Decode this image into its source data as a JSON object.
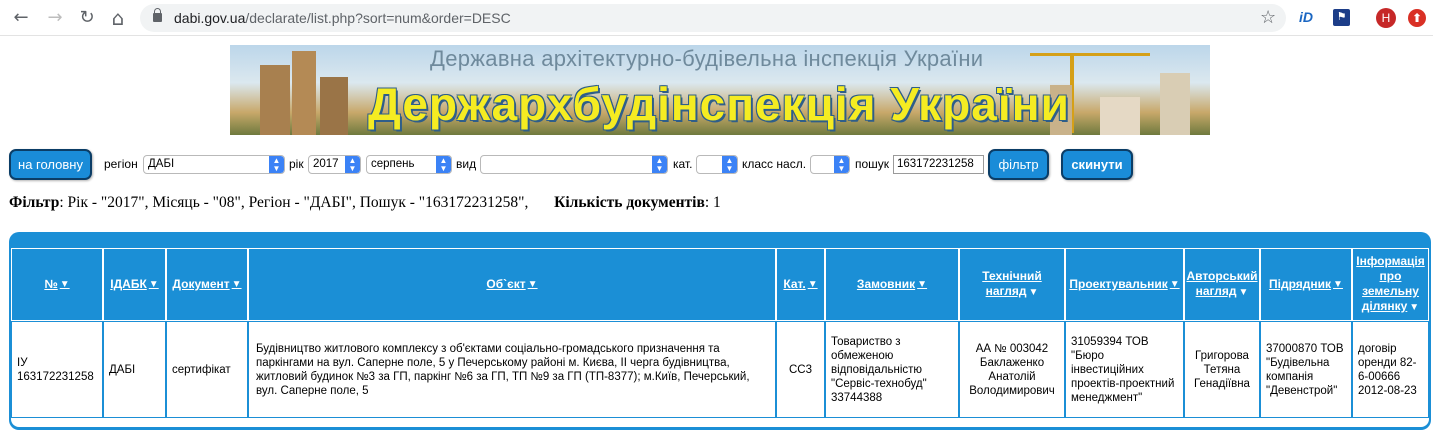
{
  "browser": {
    "url_host": "dabi.gov.ua",
    "url_path": "/declarate/list.php?sort=num&order=DESC",
    "back_icon": "←",
    "forward_icon": "→",
    "reload_icon": "↻",
    "home_icon": "⌂",
    "star_icon": "☆",
    "ext_id_label": "iD",
    "avatar_letter": "Н",
    "update_icon": "⬆"
  },
  "banner": {
    "subtitle": "Державна архітектурно-будівельна інспекція України",
    "title": "Держархбудінспекція України"
  },
  "filters": {
    "home_button": "на головну",
    "region_label": "регіон",
    "region_value": "ДАБІ",
    "year_label": "рік",
    "year_value": "2017",
    "month_value": "серпень",
    "type_label": "вид",
    "type_value": "",
    "category_label": "кат.",
    "category_value": "",
    "class_label": "класс насл.",
    "class_value": "",
    "search_label": "пошук",
    "search_value": "163172231258",
    "filter_button": "фільтр",
    "reset_button": "скинути"
  },
  "summary": {
    "filter_label": "Фільтр",
    "filter_text": ": Рік - \"2017\", Місяць - \"08\", Регіон - \"ДАБІ\", Пошук - \"163172231258\",",
    "count_label": "Кількість документів",
    "count_text": ": 1"
  },
  "table": {
    "sort_icon": "▼",
    "headers": {
      "num": "№",
      "idabk": "ІДАБК",
      "document": "Документ",
      "object": "Об`єкт",
      "category": "Кат.",
      "customer": "Замовник",
      "tech_supervision_1": "Технічний",
      "tech_supervision_2": "нагляд",
      "designer": "Проектувальник",
      "author_supervision_1": "Авторський",
      "author_supervision_2": "нагляд",
      "contractor": "Підрядник",
      "land_1": "Інформація",
      "land_2": "про",
      "land_3": "земельну",
      "land_4": "ділянку"
    },
    "rows": [
      {
        "num": "ІУ 163172231258",
        "idabk": "ДАБІ",
        "document": "сертифікат",
        "object": "Будівництво житлового комплексу з об'єктами соціально-громадського призначення та паркінгами на вул. Саперне поле, 5 у Печерському районі м. Києва, ІІ черга будівництва, житловий будинок №3 за ГП, паркінг №6 за ГП, ТП №9 за ГП (ТП-8377); м.Київ, Печерський, вул. Саперне поле, 5",
        "category": "СС3",
        "customer": "Товариство з обмеженою відповідальністю \"Сервіс-технобуд\" 33744388",
        "tech_supervision": "АА № 003042 Баклаженко Анатолій Володимирович",
        "designer": "31059394 ТОВ \"Бюро інвестиційних проектів-проектний менеджмент\"",
        "author_supervision": "Григорова Тетяна Генадіївна",
        "contractor": "37000870 ТОВ \"Будівельна компанія \"Девенстрой\"",
        "land": "договір оренди 82-6-00666 2012-08-23"
      }
    ]
  }
}
